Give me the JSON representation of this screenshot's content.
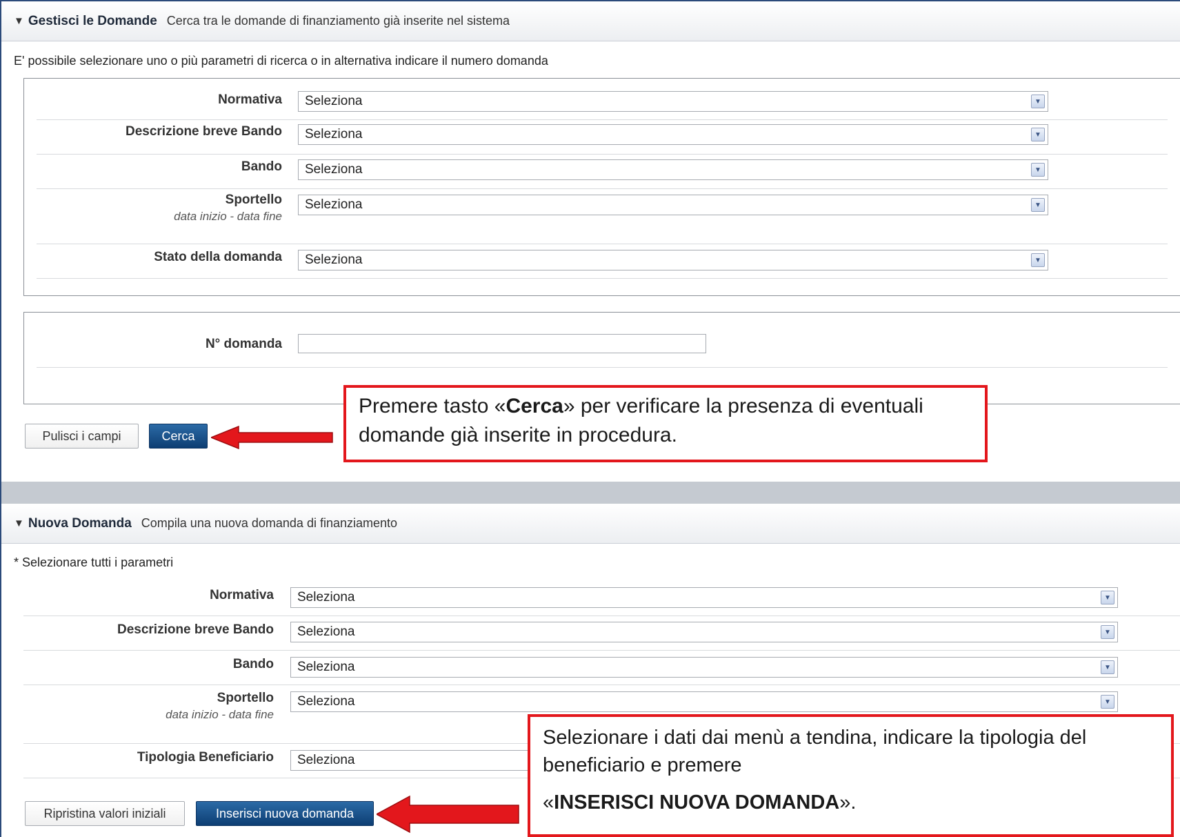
{
  "search_section": {
    "title": "Gestisci le Domande",
    "subtitle": "Cerca tra le domande di finanziamento già inserite nel sistema",
    "hint": "E' possibile selezionare uno o più parametri di ricerca o in alternativa indicare il numero domanda",
    "fields": [
      {
        "label": "Normativa",
        "value": "Seleziona"
      },
      {
        "label": "Descrizione breve Bando",
        "value": "Seleziona"
      },
      {
        "label": "Bando",
        "value": "Seleziona"
      },
      {
        "label": "Sportello",
        "sublabel": "data inizio - data fine",
        "value": "Seleziona"
      },
      {
        "label": "Stato della domanda",
        "value": "Seleziona"
      }
    ],
    "number_label": "N° domanda",
    "number_value": "",
    "clear_button": "Pulisci i campi",
    "search_button": "Cerca"
  },
  "new_section": {
    "title": "Nuova Domanda",
    "subtitle": "Compila una nuova domanda di finanziamento",
    "hint": "* Selezionare tutti i parametri",
    "fields": [
      {
        "label": "Normativa",
        "value": "Seleziona"
      },
      {
        "label": "Descrizione breve Bando",
        "value": "Seleziona"
      },
      {
        "label": "Bando",
        "value": "Seleziona"
      },
      {
        "label": "Sportello",
        "sublabel": "data inizio - data fine",
        "value": "Seleziona"
      },
      {
        "label": "Tipologia Beneficiario",
        "value": "Seleziona"
      }
    ],
    "reset_button": "Ripristina valori iniziali",
    "insert_button": "Inserisci nuova domanda"
  },
  "callouts": {
    "search": {
      "pre": "Premere tasto «",
      "bold": "Cerca",
      "post": "» per verificare la presenza di eventuali domande già inserite in procedura."
    },
    "insert": {
      "line1": "Selezionare i dati dai menù a tendina, indicare la tipologia del beneficiario e premere",
      "pre": "«",
      "bold": "INSERISCI NUOVA DOMANDA",
      "post": "»."
    }
  },
  "colors": {
    "accent": "#0d3e73",
    "callout_border": "#e3171c",
    "frame": "#2b4a7a"
  }
}
